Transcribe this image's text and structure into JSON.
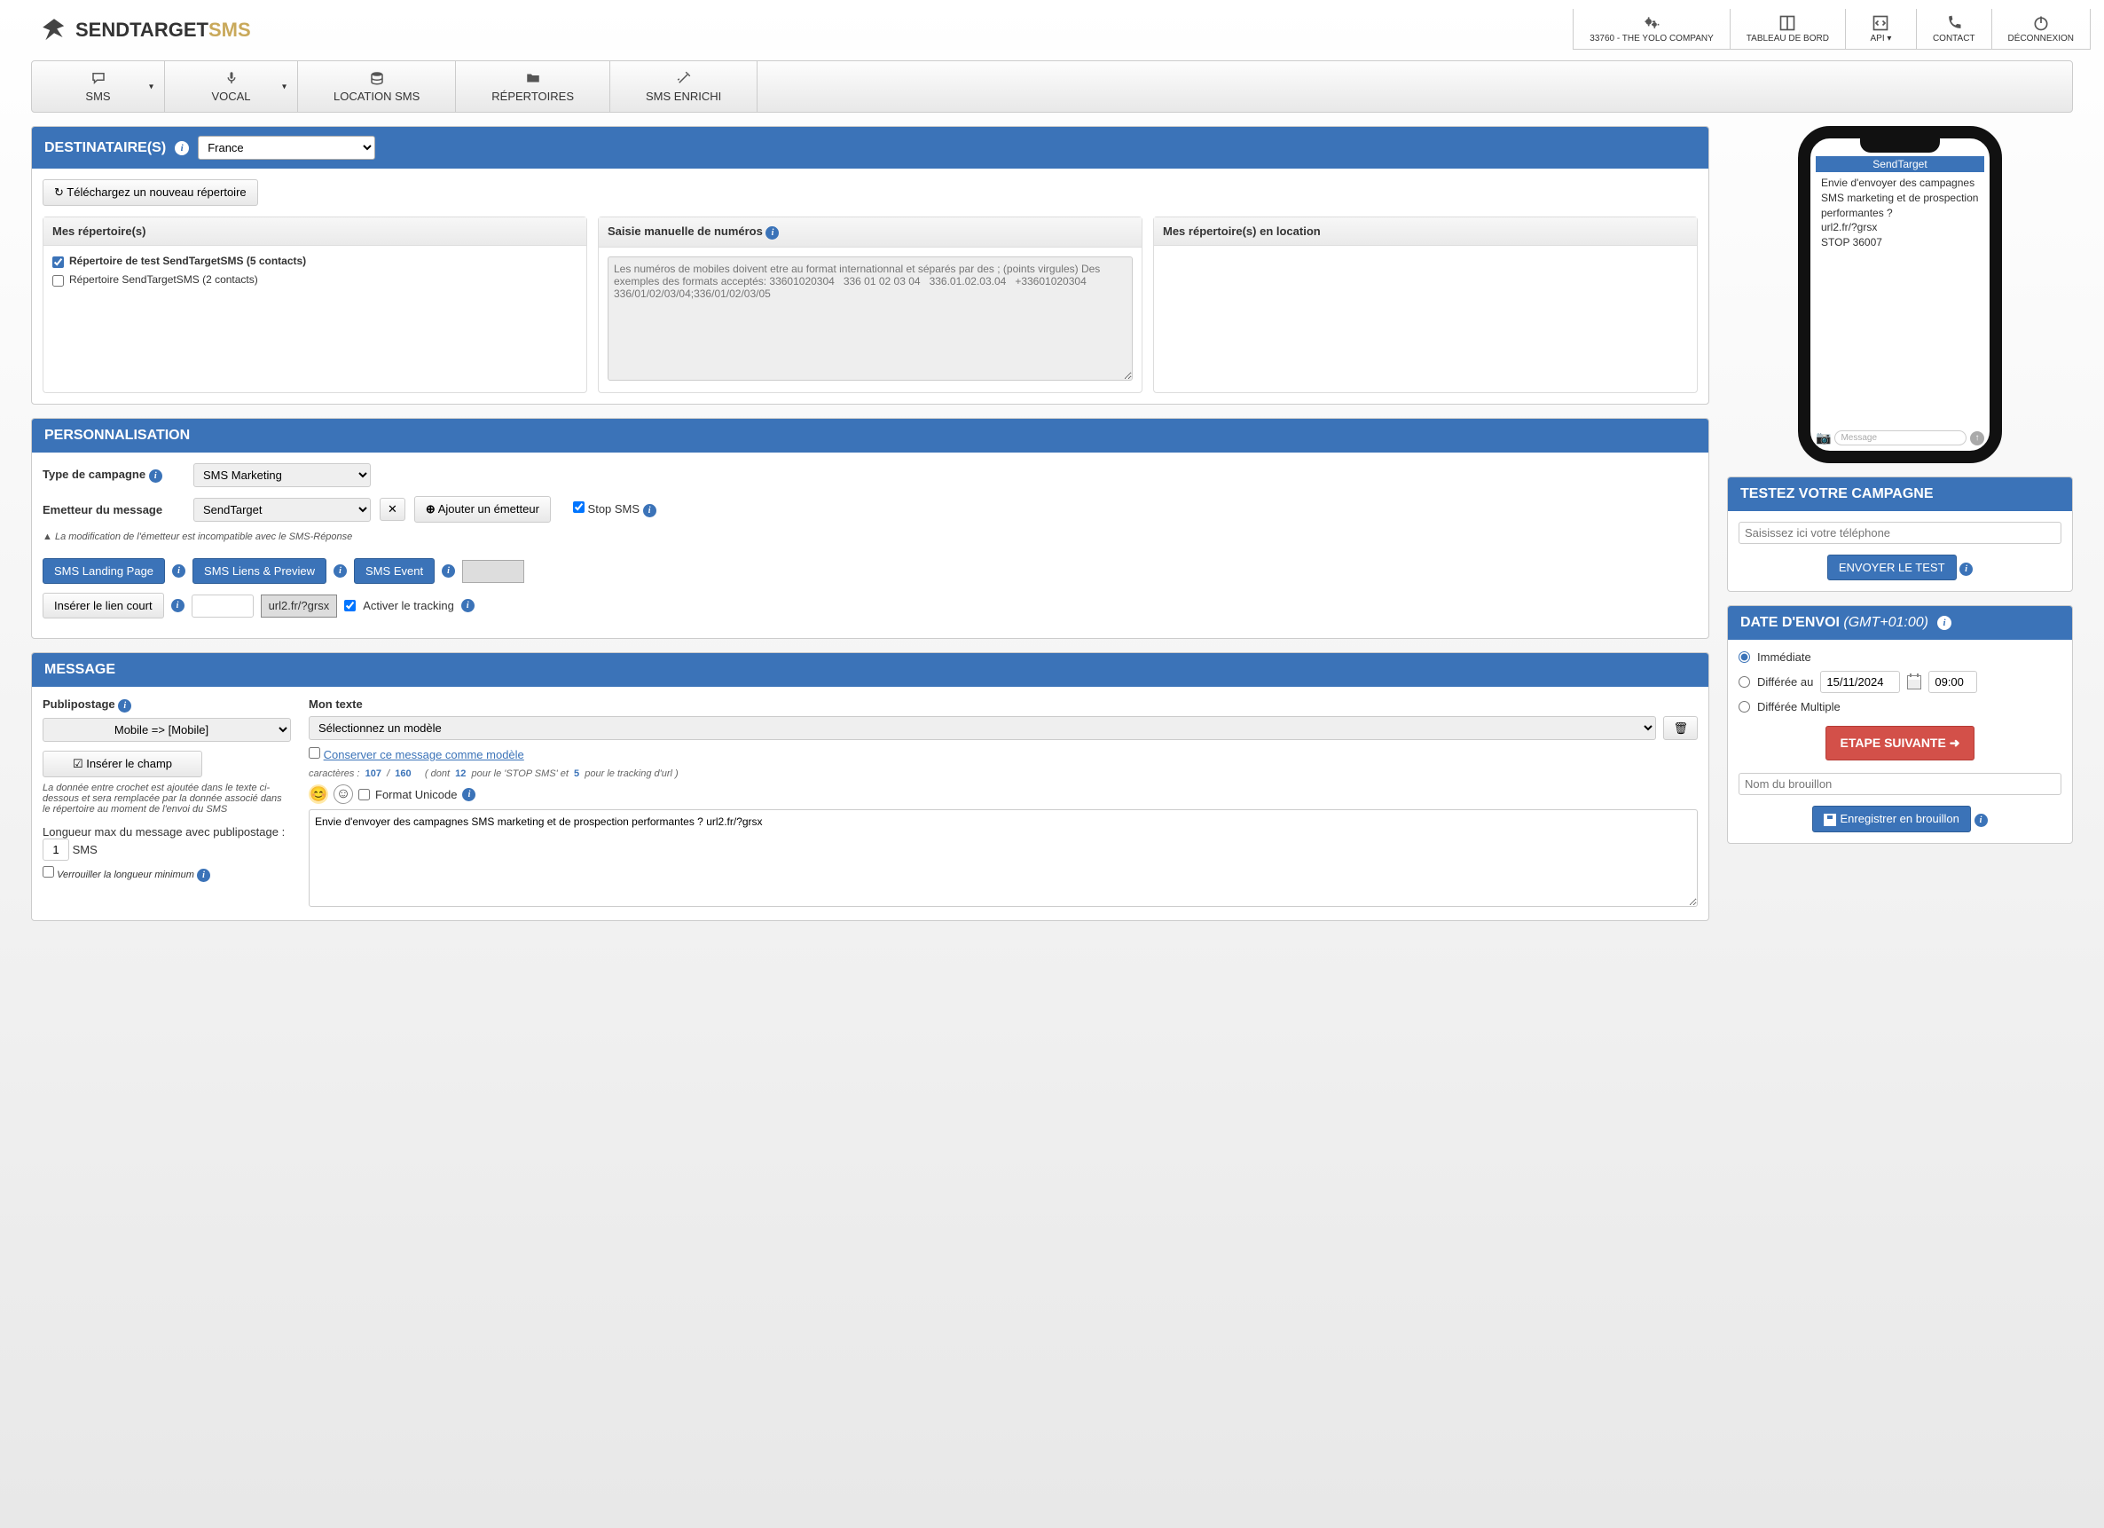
{
  "brand": {
    "name1": "SENDTARGET",
    "name2": "SMS"
  },
  "topmenu": {
    "company": "33760 - THE YOLO COMPANY",
    "dashboard": "TABLEAU DE BORD",
    "api": "API",
    "contact": "CONTACT",
    "logout": "DÉCONNEXION"
  },
  "nav": {
    "sms": "SMS",
    "vocal": "VOCAL",
    "location": "LOCATION SMS",
    "repertoires": "RÉPERTOIRES",
    "enrichi": "SMS ENRICHI"
  },
  "dest": {
    "title": "DESTINATAIRE(S)",
    "country": "France",
    "upload_btn": "Téléchargez un nouveau répertoire",
    "col1_title": "Mes répertoire(s)",
    "col2_title": "Saisie manuelle de numéros",
    "col3_title": "Mes répertoire(s) en location",
    "repo1": "Répertoire de test SendTargetSMS (5 contacts)",
    "repo2": "Répertoire SendTargetSMS (2 contacts)",
    "manual_placeholder": "Les numéros de mobiles doivent etre au format internationnal et séparés par des ; (points virgules) Des exemples des formats acceptés: 33601020304   336 01 02 03 04   336.01.02.03.04   +33601020304   336/01/02/03/04;336/01/02/03/05"
  },
  "perso": {
    "title": "PERSONNALISATION",
    "type_label": "Type de campagne",
    "type_value": "SMS Marketing",
    "emitter_label": "Emetteur du message",
    "emitter_value": "SendTarget",
    "add_emitter": "Ajouter un émetteur",
    "stop_sms": "Stop SMS",
    "warning": "La modification de l'émetteur est incompatible avec le SMS-Réponse",
    "landing": "SMS Landing Page",
    "liens": "SMS Liens & Preview",
    "event": "SMS Event",
    "insert_link": "Insérer le lien court",
    "url": "url2.fr/?grsx",
    "tracking": "Activer le tracking"
  },
  "msg": {
    "title": "MESSAGE",
    "pub_label": "Publipostage",
    "mobile_field": "Mobile    =>    [Mobile]",
    "insert_field": "Insérer le champ",
    "pub_help": "La donnée entre crochet est ajoutée dans le texte ci-dessous et sera remplacée par la donnée associé dans le répertoire au moment de l'envoi du SMS",
    "max_label": "Longueur max du message avec publipostage :",
    "max_val": "1",
    "max_unit": "SMS",
    "lock": "Verrouiller la longueur minimum",
    "my_text": "Mon texte",
    "template_ph": "Sélectionnez un modèle",
    "save_template": " Conserver ce message comme modèle",
    "chars_prefix": "caractères :",
    "chars_used": "107",
    "chars_sep": "/",
    "chars_total": "160",
    "dont": "( dont",
    "stop_n": "12",
    "stop_txt": "pour le 'STOP SMS' et",
    "track_n": "5",
    "track_txt": "pour le tracking d'url )",
    "unicode": "Format Unicode",
    "text": "Envie d'envoyer des campagnes SMS marketing et de prospection performantes ? url2.fr/?grsx"
  },
  "phone": {
    "sender": "SendTarget",
    "body": "Envie d'envoyer des campagnes SMS marketing et de prospection performantes ?\nurl2.fr/?grsx\nSTOP 36007",
    "input_ph": "Message"
  },
  "test": {
    "title": "TESTEZ VOTRE CAMPAGNE",
    "phone_ph": "Saisissez ici votre téléphone",
    "send": "ENVOYER LE TEST"
  },
  "send": {
    "title_a": "DATE D'ENVOI ",
    "title_b": "(GMT+01:00)",
    "immediate": "Immédiate",
    "deferred": "Différée au",
    "date": "15/11/2024",
    "time": "09:00",
    "multiple": "Différée Multiple",
    "next": "ETAPE SUIVANTE",
    "draft_ph": "Nom du brouillon",
    "save_draft": "Enregistrer en brouillon"
  }
}
